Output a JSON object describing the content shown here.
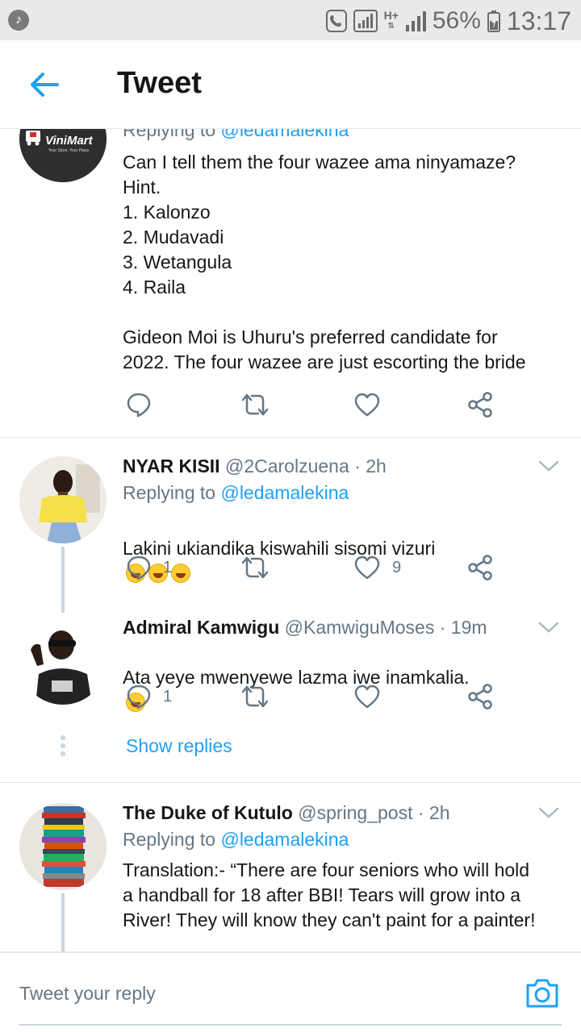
{
  "status_bar": {
    "battery_percent": "56%",
    "time": "13:17",
    "network": "H+"
  },
  "app_bar": {
    "title": "Tweet"
  },
  "tweets": [
    {
      "replying_to_prefix": "Replying to ",
      "replying_to_handle": "@ledamalekina",
      "avatar_text": "ViniMart",
      "avatar_subtext": "Your Store, Your Place",
      "text": "Can I tell them the four wazee ama ninyamaze?\nHint.\n1. Kalonzo\n2. Mudavadi\n3. Wetangula\n4. Raila\n\nGideon Moi is Uhuru's preferred candidate for\n2022. The four wazee are just escorting the bride"
    },
    {
      "name": "NYAR KISII",
      "handle": "@2Carolzuena",
      "time": "· 2h",
      "replying_to_prefix": "Replying to ",
      "replying_to_handle": "@ledamalekina",
      "text": "Lakini ukiandika kiswahili sisomi vizuri",
      "reply_count": "1",
      "like_count": "9"
    },
    {
      "name": "Admiral Kamwigu",
      "handle": "@KamwiguMoses",
      "time": "· 19m",
      "text": "Ata yeye mwenyewe lazma iwe inamkalia.",
      "reply_count": "1",
      "show_replies": "Show replies"
    },
    {
      "name": "The Duke of Kutulo",
      "handle": "@spring_post",
      "time": "· 2h",
      "replying_to_prefix": "Replying to ",
      "replying_to_handle": "@ledamalekina",
      "text": "Translation:- “There are four seniors who will hold\na handball for 18 after BBI! Tears will grow into a\nRiver! They will know they can't paint for a painter!"
    }
  ],
  "reply_bar": {
    "placeholder": "Tweet your reply"
  },
  "colors": {
    "accent": "#1da1f2",
    "secondary_text": "#657786",
    "primary_text": "#14171a",
    "divider": "#e1e8ed"
  }
}
